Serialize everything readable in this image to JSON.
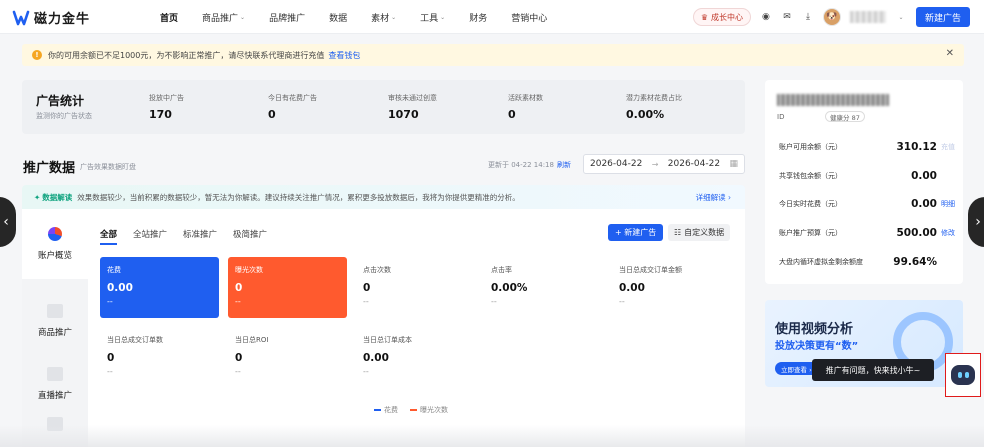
{
  "brand": {
    "name": "磁力金牛"
  },
  "nav": {
    "items": [
      {
        "label": "首页",
        "active": true,
        "dropdown": false
      },
      {
        "label": "商品推广",
        "active": false,
        "dropdown": true
      },
      {
        "label": "品牌推广",
        "active": false,
        "dropdown": false
      },
      {
        "label": "数据",
        "active": false,
        "dropdown": false
      },
      {
        "label": "素材",
        "active": false,
        "dropdown": true
      },
      {
        "label": "工具",
        "active": false,
        "dropdown": true
      },
      {
        "label": "财务",
        "active": false,
        "dropdown": false
      },
      {
        "label": "营销中心",
        "active": false,
        "dropdown": false
      }
    ],
    "growth_label": "成长中心",
    "new_ad_label": "新建广告"
  },
  "notice": {
    "text": "你的可用余额已不足1000元，为不影响正常推广，请尽快联系代理商进行充值",
    "link": "查看钱包"
  },
  "ad_stats": {
    "title": "广告统计",
    "subtitle": "监测你的广告状态",
    "items": [
      {
        "label": "投放中广告",
        "value": "170"
      },
      {
        "label": "今日有花费广告",
        "value": "0"
      },
      {
        "label": "审核未通过创意",
        "value": "1070"
      },
      {
        "label": "活跃素材数",
        "value": "0"
      },
      {
        "label": "潜力素材花费占比",
        "value": "0.00%"
      }
    ]
  },
  "promo_data": {
    "title": "推广数据",
    "subtitle": "广告效果数据盯盘",
    "updated": "更新于 04-22 14:18",
    "refresh": "刷新",
    "date_start": "2026-04-22",
    "date_end": "2026-04-22"
  },
  "insight": {
    "tag": "数据解读",
    "text": "效果数据较少，当前积累的数据较少，暂无法为你解读。建议持续关注推广情况，累积更多投放数据后，我将为你提供更精准的分析。",
    "detail": "详细解读 ›"
  },
  "left_tabs": [
    {
      "label": "账户概览",
      "active": true
    },
    {
      "label": "商品推广",
      "active": false
    },
    {
      "label": "直播推广",
      "active": false
    }
  ],
  "sub_tabs": [
    {
      "label": "全部",
      "active": true
    },
    {
      "label": "全站推广",
      "active": false
    },
    {
      "label": "标准推广",
      "active": false
    },
    {
      "label": "极简推广",
      "active": false
    }
  ],
  "panel_buttons": {
    "new_ad": "+ 新建广告",
    "custom": "自定义数据"
  },
  "metrics": [
    {
      "label": "花费",
      "value": "0.00",
      "dash": "--",
      "style": "blue"
    },
    {
      "label": "曝光次数",
      "value": "0",
      "dash": "--",
      "style": "orange"
    },
    {
      "label": "点击次数",
      "value": "0",
      "dash": "--",
      "style": "plain"
    },
    {
      "label": "点击率",
      "value": "0.00%",
      "dash": "--",
      "style": "plain"
    },
    {
      "label": "当日总成交订单金额",
      "value": "0.00",
      "dash": "--",
      "style": "plain"
    },
    {
      "label": "当日总成交订单数",
      "value": "0",
      "dash": "--",
      "style": "plain"
    },
    {
      "label": "当日总ROI",
      "value": "0",
      "dash": "--",
      "style": "plain"
    },
    {
      "label": "当日总订单成本",
      "value": "0.00",
      "dash": "--",
      "style": "plain"
    }
  ],
  "legend": [
    {
      "label": "花费",
      "color": "#1f5ff0"
    },
    {
      "label": "曝光次数",
      "color": "#ff5a2e"
    }
  ],
  "account": {
    "id_label": "ID",
    "score": "健康分 87",
    "rows": [
      {
        "label": "账户可用余额（元）",
        "value": "310.12",
        "action": "充值",
        "dim": true
      },
      {
        "label": "共享钱包余额（元）",
        "value": "0.00",
        "action": "",
        "dim": false
      },
      {
        "label": "今日实时花费（元）",
        "value": "0.00",
        "action": "明细",
        "dim": false
      },
      {
        "label": "账户推广预算（元）",
        "value": "500.00",
        "action": "修改",
        "dim": false
      },
      {
        "label": "大盘内循环虚拟金剩余额度",
        "value": "99.64%",
        "action": "",
        "dim": false
      }
    ]
  },
  "promo": {
    "title": "使用视频分析",
    "subtitle": "投放决策更有“数”",
    "button": "立即查看 ›"
  },
  "assistant": {
    "tooltip": "推广有问题，快来找小牛~"
  },
  "colors": {
    "accent": "#1f5ff0",
    "orange": "#ff5a2e",
    "notice_bg": "#fff8e1"
  }
}
